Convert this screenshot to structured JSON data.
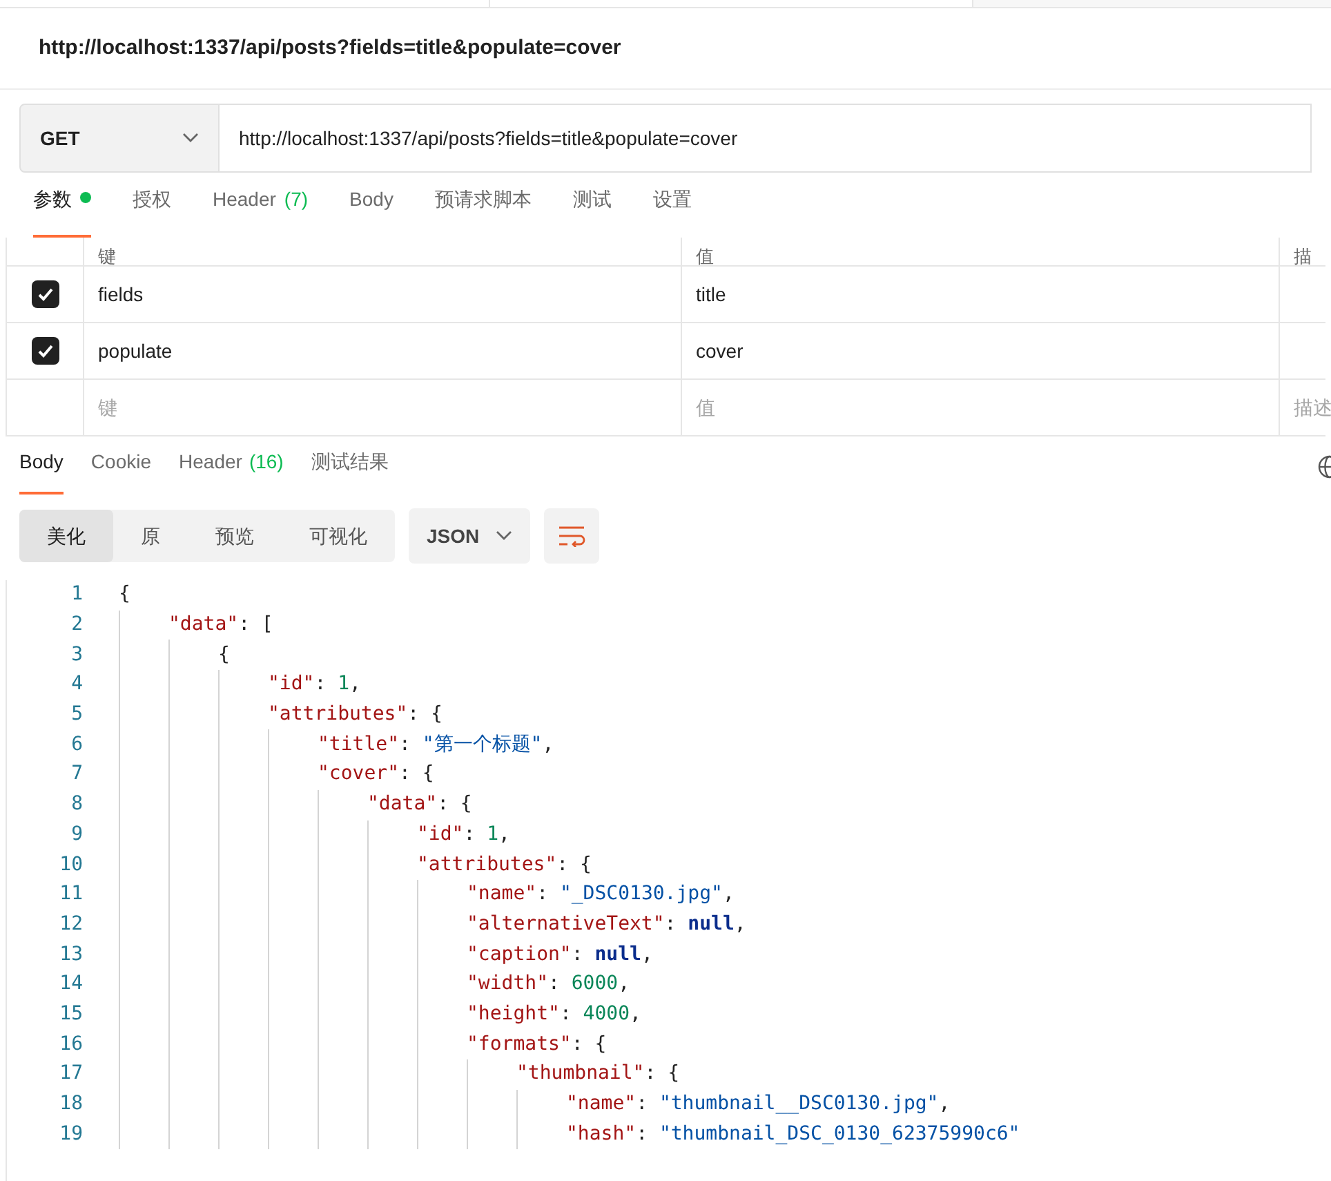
{
  "request_title": "http://localhost:1337/api/posts?fields=title&populate=cover",
  "method": "GET",
  "url": "http://localhost:1337/api/posts?fields=title&populate=cover",
  "request_tabs": [
    {
      "label": "参数",
      "selected": true,
      "dot": true
    },
    {
      "label": "授权",
      "selected": false,
      "dot": false
    },
    {
      "label": "Header",
      "count": "(7)",
      "selected": false,
      "dot": false
    },
    {
      "label": "Body",
      "selected": false,
      "dot": false
    },
    {
      "label": "预请求脚本",
      "selected": false,
      "dot": false
    },
    {
      "label": "测试",
      "selected": false,
      "dot": false
    },
    {
      "label": "设置",
      "selected": false,
      "dot": false
    }
  ],
  "params": {
    "columns": [
      "键",
      "值",
      "描"
    ],
    "rows": [
      {
        "key": "fields",
        "value": "title",
        "checked": true
      },
      {
        "key": "populate",
        "value": "cover",
        "checked": true
      }
    ],
    "placeholders": [
      "键",
      "值",
      "描述"
    ]
  },
  "response_tabs": [
    {
      "label": "Body",
      "selected": true
    },
    {
      "label": "Cookie",
      "selected": false
    },
    {
      "label": "Header",
      "count": "(16)",
      "selected": false
    },
    {
      "label": "测试结果",
      "selected": false
    }
  ],
  "view_modes": [
    {
      "label": "美化",
      "selected": true
    },
    {
      "label": "原",
      "selected": false
    },
    {
      "label": "预览",
      "selected": false
    },
    {
      "label": "可视化",
      "selected": false
    }
  ],
  "format": "JSON",
  "code": [
    {
      "n": "1",
      "tokens": [
        {
          "kind": "punct",
          "text": "{"
        }
      ],
      "children": [
        {
          "n": "2",
          "tokens": [
            {
              "kind": "key",
              "text": "\"data\""
            },
            {
              "kind": "punct",
              "text": ": ["
            }
          ],
          "children": [
            {
              "n": "3",
              "tokens": [
                {
                  "kind": "punct",
                  "text": "{"
                }
              ],
              "children": [
                {
                  "n": "4",
                  "tokens": [
                    {
                      "kind": "key",
                      "text": "\"id\""
                    },
                    {
                      "kind": "punct",
                      "text": ": "
                    },
                    {
                      "kind": "number",
                      "text": "1"
                    },
                    {
                      "kind": "punct",
                      "text": ","
                    }
                  ]
                },
                {
                  "n": "5",
                  "tokens": [
                    {
                      "kind": "key",
                      "text": "\"attributes\""
                    },
                    {
                      "kind": "punct",
                      "text": ": {"
                    }
                  ],
                  "children": [
                    {
                      "n": "6",
                      "tokens": [
                        {
                          "kind": "key",
                          "text": "\"title\""
                        },
                        {
                          "kind": "punct",
                          "text": ": "
                        },
                        {
                          "kind": "string",
                          "text": "\"第一个标题\""
                        },
                        {
                          "kind": "punct",
                          "text": ","
                        }
                      ]
                    },
                    {
                      "n": "7",
                      "tokens": [
                        {
                          "kind": "key",
                          "text": "\"cover\""
                        },
                        {
                          "kind": "punct",
                          "text": ": {"
                        }
                      ],
                      "children": [
                        {
                          "n": "8",
                          "tokens": [
                            {
                              "kind": "key",
                              "text": "\"data\""
                            },
                            {
                              "kind": "punct",
                              "text": ": {"
                            }
                          ],
                          "children": [
                            {
                              "n": "9",
                              "tokens": [
                                {
                                  "kind": "key",
                                  "text": "\"id\""
                                },
                                {
                                  "kind": "punct",
                                  "text": ": "
                                },
                                {
                                  "kind": "number",
                                  "text": "1"
                                },
                                {
                                  "kind": "punct",
                                  "text": ","
                                }
                              ]
                            },
                            {
                              "n": "10",
                              "tokens": [
                                {
                                  "kind": "key",
                                  "text": "\"attributes\""
                                },
                                {
                                  "kind": "punct",
                                  "text": ": {"
                                }
                              ],
                              "children": [
                                {
                                  "n": "11",
                                  "tokens": [
                                    {
                                      "kind": "key",
                                      "text": "\"name\""
                                    },
                                    {
                                      "kind": "punct",
                                      "text": ": "
                                    },
                                    {
                                      "kind": "string",
                                      "text": "\"_DSC0130.jpg\""
                                    },
                                    {
                                      "kind": "punct",
                                      "text": ","
                                    }
                                  ]
                                },
                                {
                                  "n": "12",
                                  "tokens": [
                                    {
                                      "kind": "key",
                                      "text": "\"alternativeText\""
                                    },
                                    {
                                      "kind": "punct",
                                      "text": ": "
                                    },
                                    {
                                      "kind": "null",
                                      "text": "null"
                                    },
                                    {
                                      "kind": "punct",
                                      "text": ","
                                    }
                                  ]
                                },
                                {
                                  "n": "13",
                                  "tokens": [
                                    {
                                      "kind": "key",
                                      "text": "\"caption\""
                                    },
                                    {
                                      "kind": "punct",
                                      "text": ": "
                                    },
                                    {
                                      "kind": "null",
                                      "text": "null"
                                    },
                                    {
                                      "kind": "punct",
                                      "text": ","
                                    }
                                  ]
                                },
                                {
                                  "n": "14",
                                  "tokens": [
                                    {
                                      "kind": "key",
                                      "text": "\"width\""
                                    },
                                    {
                                      "kind": "punct",
                                      "text": ": "
                                    },
                                    {
                                      "kind": "number",
                                      "text": "6000"
                                    },
                                    {
                                      "kind": "punct",
                                      "text": ","
                                    }
                                  ]
                                },
                                {
                                  "n": "15",
                                  "tokens": [
                                    {
                                      "kind": "key",
                                      "text": "\"height\""
                                    },
                                    {
                                      "kind": "punct",
                                      "text": ": "
                                    },
                                    {
                                      "kind": "number",
                                      "text": "4000"
                                    },
                                    {
                                      "kind": "punct",
                                      "text": ","
                                    }
                                  ]
                                },
                                {
                                  "n": "16",
                                  "tokens": [
                                    {
                                      "kind": "key",
                                      "text": "\"formats\""
                                    },
                                    {
                                      "kind": "punct",
                                      "text": ": {"
                                    }
                                  ],
                                  "children": [
                                    {
                                      "n": "17",
                                      "tokens": [
                                        {
                                          "kind": "key",
                                          "text": "\"thumbnail\""
                                        },
                                        {
                                          "kind": "punct",
                                          "text": ": {"
                                        }
                                      ],
                                      "children": [
                                        {
                                          "n": "18",
                                          "tokens": [
                                            {
                                              "kind": "key",
                                              "text": "\"name\""
                                            },
                                            {
                                              "kind": "punct",
                                              "text": ": "
                                            },
                                            {
                                              "kind": "string",
                                              "text": "\"thumbnail__DSC0130.jpg\""
                                            },
                                            {
                                              "kind": "punct",
                                              "text": ","
                                            }
                                          ]
                                        },
                                        {
                                          "n": "19",
                                          "tokens": [
                                            {
                                              "kind": "key",
                                              "text": "\"hash\""
                                            },
                                            {
                                              "kind": "punct",
                                              "text": ": "
                                            },
                                            {
                                              "kind": "string",
                                              "text": "\"thumbnail_DSC_0130_62375990c6\""
                                            }
                                          ]
                                        }
                                      ]
                                    }
                                  ]
                                }
                              ]
                            }
                          ]
                        }
                      ]
                    }
                  ]
                }
              ]
            }
          ]
        }
      ]
    }
  ]
}
